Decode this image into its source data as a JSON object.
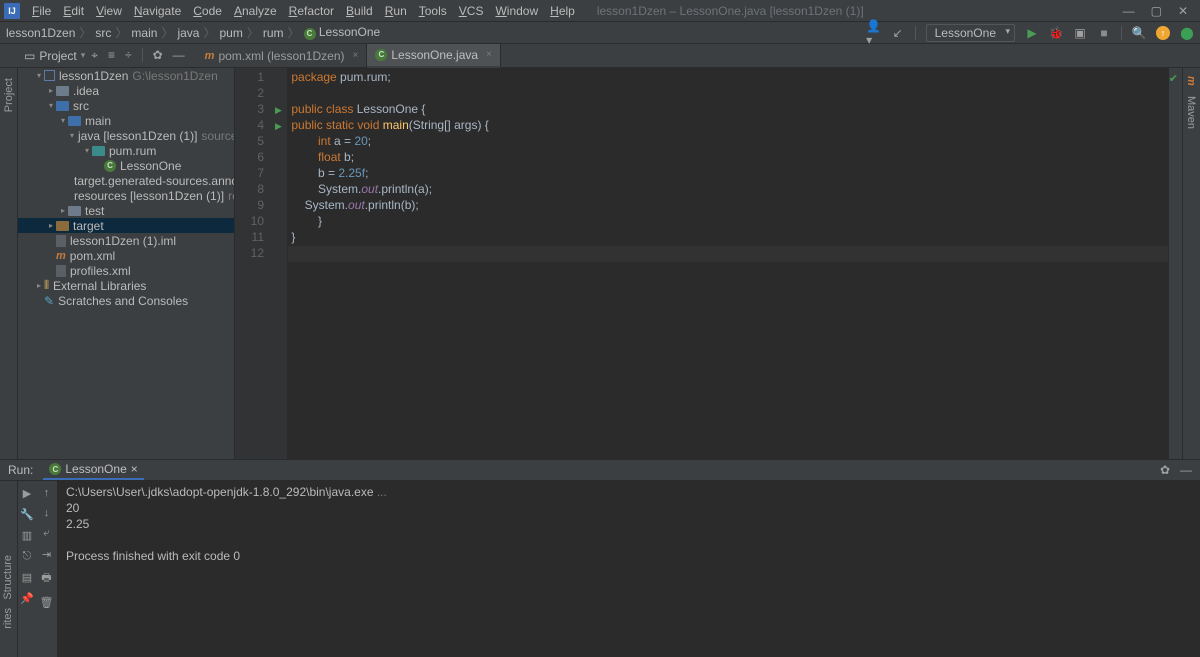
{
  "menubar": {
    "items": [
      "File",
      "Edit",
      "View",
      "Navigate",
      "Code",
      "Analyze",
      "Refactor",
      "Build",
      "Run",
      "Tools",
      "VCS",
      "Window",
      "Help"
    ],
    "title": "lesson1Dzen – LessonOne.java [lesson1Dzen (1)]"
  },
  "breadcrumbs": [
    "lesson1Dzen",
    "src",
    "main",
    "java",
    "pum",
    "rum",
    "LessonOne"
  ],
  "run_config": "LessonOne",
  "project_label": "Project",
  "editor_tabs": [
    {
      "label": "pom.xml (lesson1Dzen)",
      "active": false,
      "icon": "m"
    },
    {
      "label": "LessonOne.java",
      "active": true,
      "icon": "c"
    }
  ],
  "tree": {
    "root": {
      "name": "lesson1Dzen",
      "hint": "G:\\lesson1Dzen"
    },
    "items": [
      {
        "indent": 1,
        "exp": "▾",
        "ico": "mod",
        "name": "lesson1Dzen",
        "hint": "G:\\lesson1Dzen",
        "sel": false
      },
      {
        "indent": 2,
        "exp": "▸",
        "ico": "fld",
        "name": ".idea"
      },
      {
        "indent": 2,
        "exp": "▾",
        "ico": "fld-blue",
        "name": "src"
      },
      {
        "indent": 3,
        "exp": "▾",
        "ico": "fld-blue",
        "name": "main"
      },
      {
        "indent": 4,
        "exp": "▾",
        "ico": "fld-blue",
        "name": "java [lesson1Dzen (1)]",
        "hint": "sources root"
      },
      {
        "indent": 5,
        "exp": "▾",
        "ico": "fld-teal",
        "name": "pum.rum"
      },
      {
        "indent": 6,
        "exp": "",
        "ico": "class",
        "name": "LessonOne"
      },
      {
        "indent": 4,
        "exp": "",
        "ico": "fld",
        "name": "target.generated-sources.annotation"
      },
      {
        "indent": 4,
        "exp": "",
        "ico": "fld-blue",
        "name": "resources [lesson1Dzen (1)]",
        "hint": "resources r"
      },
      {
        "indent": 3,
        "exp": "▸",
        "ico": "fld",
        "name": "test"
      },
      {
        "indent": 2,
        "exp": "▸",
        "ico": "fld-orange",
        "name": "target",
        "sel": true
      },
      {
        "indent": 2,
        "exp": "",
        "ico": "file",
        "name": "lesson1Dzen (1).iml"
      },
      {
        "indent": 2,
        "exp": "",
        "ico": "maven",
        "name": "pom.xml"
      },
      {
        "indent": 2,
        "exp": "",
        "ico": "file",
        "name": "profiles.xml"
      },
      {
        "indent": 1,
        "exp": "▸",
        "ico": "lib",
        "name": "External Libraries"
      },
      {
        "indent": 1,
        "exp": "",
        "ico": "scratch",
        "name": "Scratches and Consoles"
      }
    ]
  },
  "code_lines": [
    {
      "n": 1,
      "html": "<span class='kw'>package </span>pum.rum;"
    },
    {
      "n": 2,
      "html": ""
    },
    {
      "n": 3,
      "html": "<span class='kw'>public class </span>LessonOne {",
      "run": true
    },
    {
      "n": 4,
      "html": "<span class='kw'>public static void </span><span class='fn'>main</span>(String[] args) {",
      "run": true
    },
    {
      "n": 5,
      "html": "        <span class='kw'>int </span>a = <span class='num'>20</span>;"
    },
    {
      "n": 6,
      "html": "        <span class='kw'>float </span>b;"
    },
    {
      "n": 7,
      "html": "        b = <span class='num'>2.25f</span>;"
    },
    {
      "n": 8,
      "html": "        System.<span class='fld'>out</span>.println(a);"
    },
    {
      "n": 9,
      "html": "    System.<span class='fld'>out</span>.println(b);"
    },
    {
      "n": 10,
      "html": "        }"
    },
    {
      "n": 11,
      "html": "}"
    },
    {
      "n": 12,
      "html": "",
      "cursor": true
    }
  ],
  "run_panel": {
    "label": "Run:",
    "tab": "LessonOne",
    "lines": [
      {
        "text": "C:\\Users\\User\\.jdks\\adopt-openjdk-1.8.0_292\\bin\\java.exe ",
        "dim": false,
        "tail": "..."
      },
      {
        "text": "20"
      },
      {
        "text": "2.25"
      },
      {
        "text": ""
      },
      {
        "text": "Process finished with exit code 0"
      }
    ]
  },
  "sidebars": {
    "left_top": "Project",
    "left_bottom": "Structure",
    "right": "Maven",
    "bl": "rites"
  }
}
